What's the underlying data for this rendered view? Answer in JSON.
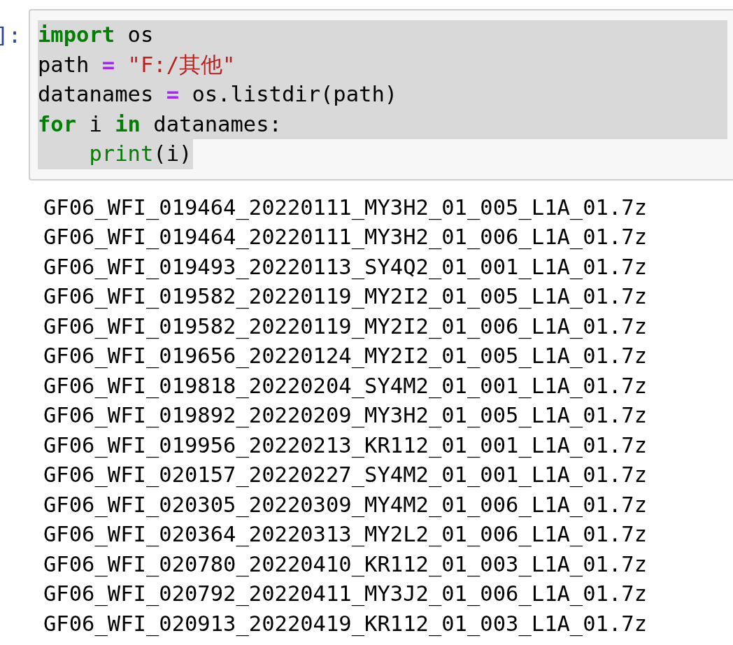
{
  "code_cell": {
    "prompt": "]:",
    "selected": true,
    "lines": [
      [
        {
          "kind": "keyword",
          "text": "import"
        },
        {
          "kind": "name",
          "text": " os"
        }
      ],
      [
        {
          "kind": "name",
          "text": "path "
        },
        {
          "kind": "operator",
          "text": "="
        },
        {
          "kind": "string",
          "text": " \"F:/其他\""
        }
      ],
      [
        {
          "kind": "name",
          "text": "datanames "
        },
        {
          "kind": "operator",
          "text": "="
        },
        {
          "kind": "name",
          "text": " os.listdir(path)"
        }
      ],
      [
        {
          "kind": "keyword",
          "text": "for"
        },
        {
          "kind": "name",
          "text": " i "
        },
        {
          "kind": "keyword",
          "text": "in"
        },
        {
          "kind": "name",
          "text": " datanames:"
        }
      ],
      [
        {
          "kind": "builtin",
          "text": "    print"
        },
        {
          "kind": "name",
          "text": "(i)"
        }
      ]
    ]
  },
  "output": [
    "GF06_WFI_019464_20220111_MY3H2_01_005_L1A_01.7z",
    "GF06_WFI_019464_20220111_MY3H2_01_006_L1A_01.7z",
    "GF06_WFI_019493_20220113_SY4Q2_01_001_L1A_01.7z",
    "GF06_WFI_019582_20220119_MY2I2_01_005_L1A_01.7z",
    "GF06_WFI_019582_20220119_MY2I2_01_006_L1A_01.7z",
    "GF06_WFI_019656_20220124_MY2I2_01_005_L1A_01.7z",
    "GF06_WFI_019818_20220204_SY4M2_01_001_L1A_01.7z",
    "GF06_WFI_019892_20220209_MY3H2_01_005_L1A_01.7z",
    "GF06_WFI_019956_20220213_KR112_01_001_L1A_01.7z",
    "GF06_WFI_020157_20220227_SY4M2_01_001_L1A_01.7z",
    "GF06_WFI_020305_20220309_MY4M2_01_006_L1A_01.7z",
    "GF06_WFI_020364_20220313_MY2L2_01_006_L1A_01.7z",
    "GF06_WFI_020780_20220410_KR112_01_003_L1A_01.7z",
    "GF06_WFI_020792_20220411_MY3J2_01_006_L1A_01.7z",
    "GF06_WFI_020913_20220419_KR112_01_003_L1A_01.7z"
  ]
}
